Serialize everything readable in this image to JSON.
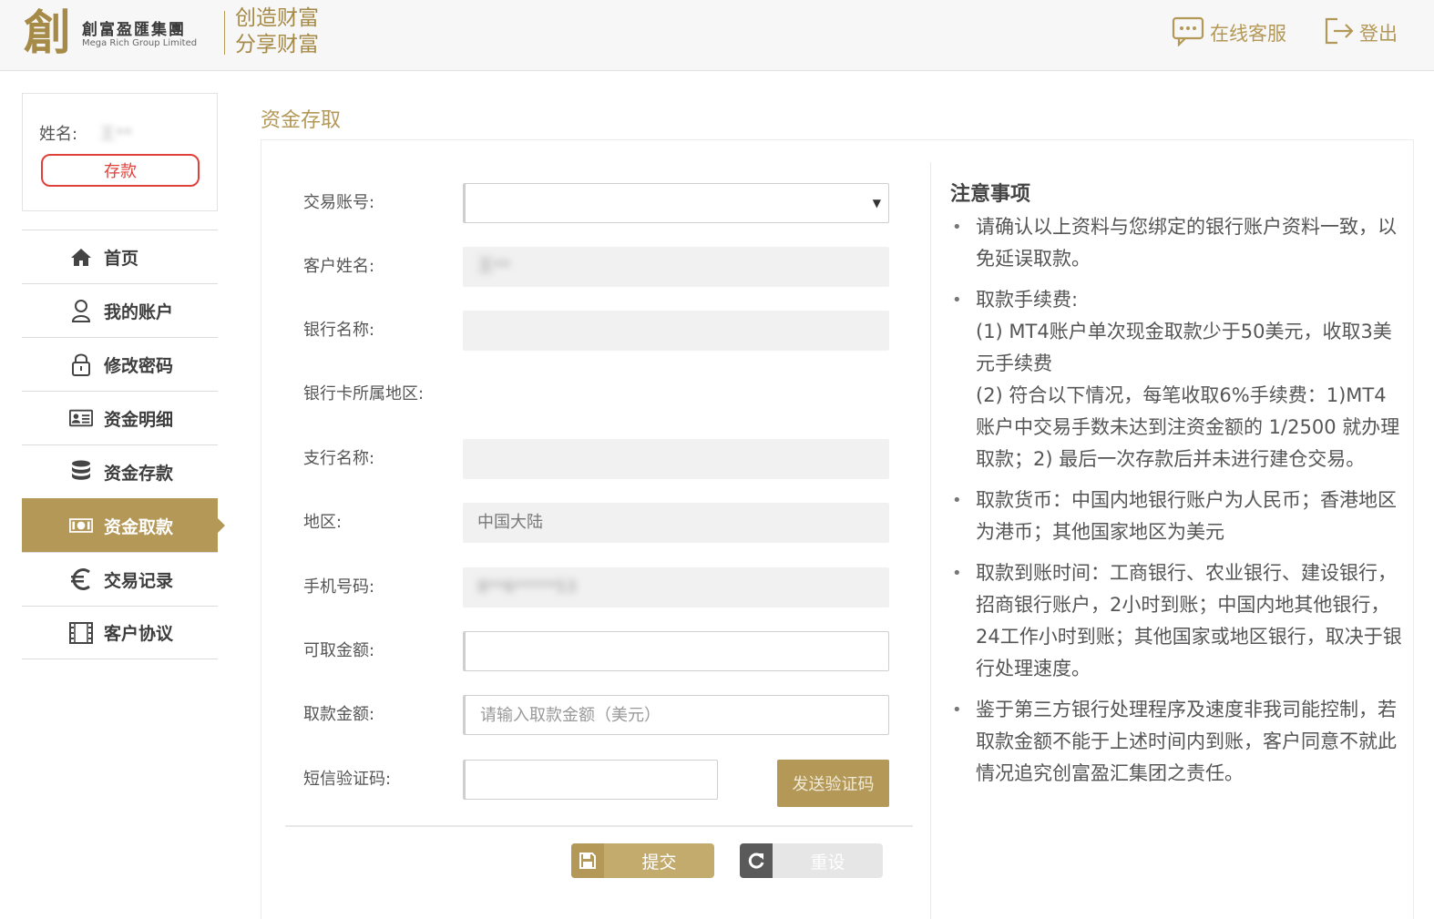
{
  "header": {
    "logo_glyph": "創",
    "logo_cn": "創富盈匯集團",
    "logo_en": "Mega Rich Group Limited",
    "slogan_line1": "创造财富",
    "slogan_line2": "分享财富",
    "service_label": "在线客服",
    "service_icon": "chat-icon",
    "logout_label": "登出",
    "logout_icon": "logout-icon",
    "accent_color": "#b39857"
  },
  "user": {
    "name_label": "姓名:",
    "name_value": "王**",
    "deposit_label": "存款"
  },
  "nav": {
    "items": [
      {
        "label": "首页",
        "icon": "home-icon"
      },
      {
        "label": "我的账户",
        "icon": "user-icon"
      },
      {
        "label": "修改密码",
        "icon": "lock-icon"
      },
      {
        "label": "资金明细",
        "icon": "id-card-icon"
      },
      {
        "label": "资金存款",
        "icon": "database-icon"
      },
      {
        "label": "资金取款",
        "icon": "money-icon",
        "active": true
      },
      {
        "label": "交易记录",
        "icon": "euro-icon"
      },
      {
        "label": "客户协议",
        "icon": "film-icon"
      }
    ]
  },
  "page": {
    "title": "资金存取"
  },
  "form": {
    "account_label": "交易账号:",
    "account_value": "",
    "client_name_label": "客户姓名:",
    "client_name_value": "王**",
    "bank_name_label": "银行名称:",
    "bank_name_value": "",
    "bank_region_label": "银行卡所属地区:",
    "branch_label": "支行名称:",
    "branch_value": "",
    "region_label": "地区:",
    "region_value": "中国大陆",
    "phone_label": "手机号码:",
    "phone_value": "8**6*****53",
    "available_label": "可取金额:",
    "available_value": "",
    "amount_label": "取款金额:",
    "amount_placeholder": "请输入取款金额（美元）",
    "sms_label": "短信验证码:",
    "sms_value": "",
    "send_code_label": "发送验证码",
    "submit_label": "提交",
    "reset_label": "重设"
  },
  "notice": {
    "title": "注意事项",
    "item1": "请确认以上资料与您绑定的银行账户资料一致，以免延误取款。",
    "item2_title": "取款手续费:",
    "item2_line1": "(1) MT4账户单次现金取款少于50美元，收取3美元手续费",
    "item2_line2": "(2) 符合以下情况，每笔收取6%手续费：1)MT4账户中交易手数未达到注资金额的 1/2500 就办理取款；2) 最后一次存款后并未进行建仓交易。",
    "item3": "取款货币：中国内地银行账户为人民币；香港地区为港币；其他国家地区为美元",
    "item4": "取款到账时间：工商银行、农业银行、建设银行，招商银行账户，2小时到账；中国内地其他银行，24工作小时到账；其他国家或地区银行，取决于银行处理速度。",
    "item5": "鉴于第三方银行处理程序及速度非我司能控制，若取款金额不能于上述时间内到账，客户同意不就此情况追究创富盈汇集团之责任。"
  }
}
